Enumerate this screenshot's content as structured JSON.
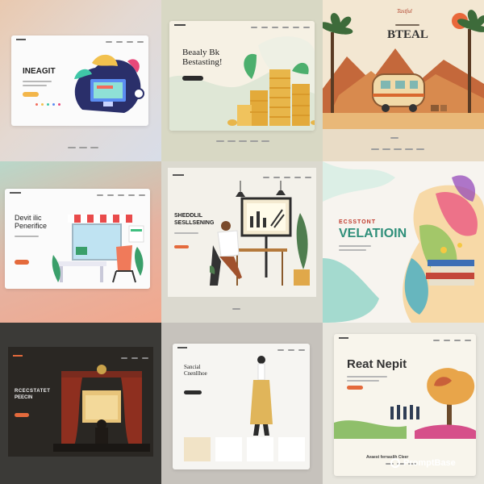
{
  "tiles": [
    {
      "heading": "INEAGIT"
    },
    {
      "heading_line1": "Beaaly Bk",
      "heading_line2": "Bestasting!"
    },
    {
      "logo_text": "Tastful",
      "heading": "BTEAL"
    },
    {
      "heading_line1": "Devit ilic",
      "heading_line2": "Penerifice"
    },
    {
      "heading_line1": "SHEDDLIL",
      "heading_line2": "SESLLSENING"
    },
    {
      "subheading": "ECSSTONT",
      "heading": "VELATIOIN"
    },
    {
      "heading_line1": "RCECSTATET",
      "heading_line2": "PEECIN"
    },
    {
      "heading_line1": "Sancial",
      "heading_line2": "Cnenllhoe"
    },
    {
      "heading": "Reat Nepit",
      "caption": "Avaest fernaslih Cleer"
    }
  ],
  "watermark": "PromptBase",
  "colors": {
    "orange_button": "#e46a3c",
    "gold": "#e8b64a",
    "teal": "#2f8f7a"
  }
}
